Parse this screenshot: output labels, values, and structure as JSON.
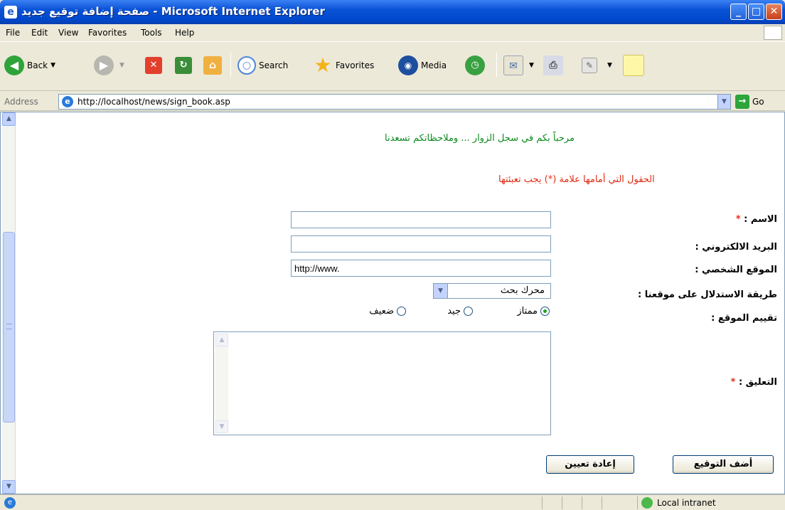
{
  "window": {
    "title": "صفحة إضافة توقيع جديد - Microsoft Internet Explorer"
  },
  "menu": [
    "File",
    "Edit",
    "View",
    "Favorites",
    "Tools",
    "Help"
  ],
  "toolbar": {
    "back": "Back",
    "search": "Search",
    "favorites": "Favorites",
    "media": "Media"
  },
  "address": {
    "label": "Address",
    "url": "http://localhost/news/sign_book.asp",
    "go": "Go"
  },
  "page": {
    "welcome": "مرحباً بكم في سجل الزوار ... وملاحظاتكم تسعدنا",
    "required_notice": "الحقول التي أمامها علامة (*) يجب تعبئتها",
    "fields": {
      "name_label": "الاسم :",
      "email_label": "البريد الالكتروني :",
      "website_label": "الموقع الشخصي :",
      "website_value": "http://www.",
      "referral_label": "طريقة الاستدلال على موقعنا :",
      "referral_value": "محرك بحث",
      "rating_label": "تقييم الموقع :",
      "rating_options": [
        "ممتاز",
        "جيد",
        "ضعيف"
      ],
      "comment_label": "التعليق :",
      "required_mark": "*"
    },
    "buttons": {
      "submit": "أضف التوقيع",
      "reset": "إعادة تعيين"
    }
  },
  "status": {
    "zone": "Local intranet"
  }
}
